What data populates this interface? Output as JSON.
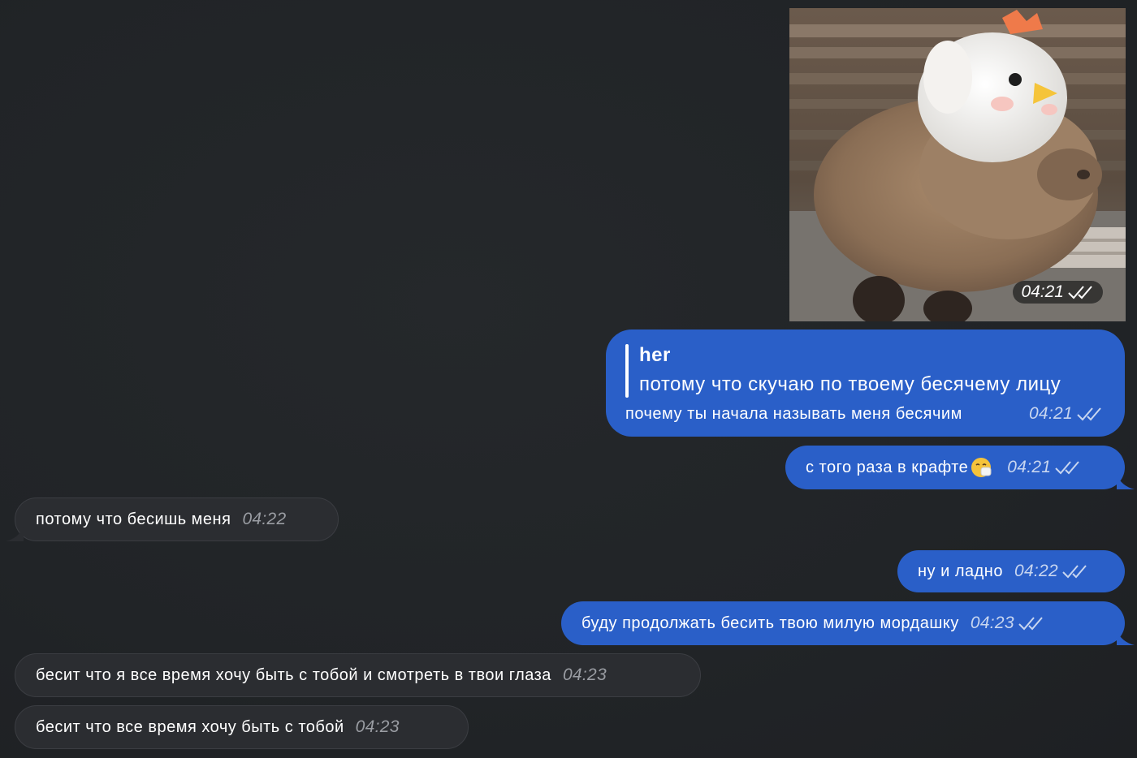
{
  "photo": {
    "alt": "capybara in chicken hat",
    "time": "04:21"
  },
  "messages": [
    {
      "id": "m1",
      "direction": "out",
      "reply_name": "her",
      "reply_text": "потому что скучаю по твоему бесячему лицу",
      "text": "почему ты начала называть меня бесячим",
      "time": "04:21",
      "status_icon": "double-check-icon"
    },
    {
      "id": "m2",
      "direction": "out",
      "text": "с того раза в крафте",
      "emoji_icon": "sneezing-face-emoji",
      "time": "04:21",
      "status_icon": "double-check-icon"
    },
    {
      "id": "m3",
      "direction": "in",
      "text": "потому что бесишь меня",
      "time": "04:22"
    },
    {
      "id": "m4",
      "direction": "out",
      "text": "ну и ладно",
      "time": "04:22",
      "status_icon": "double-check-icon"
    },
    {
      "id": "m5",
      "direction": "out",
      "text": "буду продолжать бесить твою милую мордашку",
      "time": "04:23",
      "status_icon": "double-check-icon"
    },
    {
      "id": "m6",
      "direction": "in",
      "text": "бесит что я все время хочу быть с тобой и смотреть в твои глаза",
      "time": "04:23"
    },
    {
      "id": "m7",
      "direction": "in",
      "text": "бесит что все время хочу быть с тобой",
      "time": "04:23"
    }
  ],
  "colors": {
    "background": "#212427",
    "outgoing_bubble": "#2a5fc8",
    "incoming_bubble": "#2b2d31"
  }
}
